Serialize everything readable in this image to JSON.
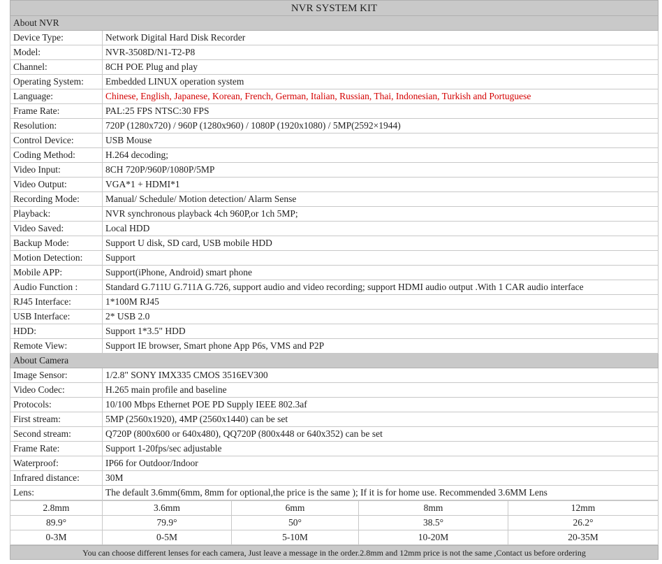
{
  "title": "NVR SYSTEM KIT",
  "sections": {
    "nvr": "About NVR",
    "camera": "About Camera"
  },
  "nvr_rows": [
    {
      "label": "Device Type:",
      "value": "Network Digital Hard Disk Recorder"
    },
    {
      "label": "Model:",
      "value": "NVR-3508D/N1-T2-P8"
    },
    {
      "label": "Channel:",
      "value": "8CH POE Plug and play"
    },
    {
      "label": "Operating System:",
      "value": "Embedded LINUX operation system"
    },
    {
      "label": "Language:",
      "value": "Chinese, English, Japanese, Korean, French, German, Italian, Russian, Thai, Indonesian, Turkish and Portuguese"
    },
    {
      "label": "Frame Rate:",
      "value": "PAL:25 FPS        NTSC:30 FPS"
    },
    {
      "label": "Resolution:",
      "value": "720P (1280x720) / 960P (1280x960) / 1080P (1920x1080) / 5MP(2592×1944)"
    },
    {
      "label": "Control  Device:",
      "value": "USB Mouse"
    },
    {
      "label": "Coding  Method:",
      "value": "H.264 decoding;"
    },
    {
      "label": "Video Input:",
      "value": "8CH 720P/960P/1080P/5MP"
    },
    {
      "label": "Video Output:",
      "value": "VGA*1  + HDMI*1"
    },
    {
      "label": "Recording Mode:",
      "value": "Manual/ Schedule/ Motion detection/ Alarm Sense"
    },
    {
      "label": "Playback:",
      "value": "NVR synchronous playback 4ch 960P,or 1ch 5MP;"
    },
    {
      "label": "Video Saved:",
      "value": "Local HDD"
    },
    {
      "label": "Backup Mode:",
      "value": "Support U disk, SD card, USB mobile HDD"
    },
    {
      "label": "Motion Detection:",
      "value": "Support"
    },
    {
      "label": "Mobile APP:",
      "value": "Support(iPhone, Android) smart phone"
    },
    {
      "label": "Audio Function :",
      "value": "Standard G.711U G.711A G.726, support audio and video recording; support HDMI audio output .With 1 CAR audio interface"
    },
    {
      "label": "RJ45  Interface:",
      "value": "1*100M RJ45"
    },
    {
      "label": "USB Interface:",
      "value": "2* USB 2.0"
    },
    {
      "label": "HDD:",
      "value": "Support 1*3.5\" HDD"
    },
    {
      "label": "Remote View:",
      "value": "Support IE browser, Smart phone App P6s, VMS and P2P"
    }
  ],
  "camera_rows": [
    {
      "label": "Image Sensor:",
      "value": "1/2.8\" SONY IMX335 CMOS  3516EV300"
    },
    {
      "label": "Video Codec:",
      "value": "H.265 main profile and baseline"
    },
    {
      "label": "Protocols:",
      "value": "10/100 Mbps Ethernet POE PD Supply IEEE 802.3af"
    },
    {
      "label": "First stream:",
      "value": "5MP (2560x1920), 4MP (2560x1440) can be set"
    },
    {
      "label": "Second stream:",
      "value": "Q720P (800x600 or 640x480), QQ720P (800x448 or 640x352) can be set"
    },
    {
      "label": "Frame Rate:",
      "value": "Support 1-20fps/sec adjustable"
    },
    {
      "label": "Waterproof:",
      "value": "IP66 for Outdoor/Indoor"
    },
    {
      "label": "Infrared distance:",
      "value": "30M"
    },
    {
      "label": "Lens:",
      "value": "The default 3.6mm(6mm, 8mm for optional,the price is the same ); If it is for home use. Recommended 3.6MM Lens"
    }
  ],
  "lens_table": [
    [
      "2.8mm",
      "3.6mm",
      "6mm",
      "8mm",
      "12mm"
    ],
    [
      "89.9°",
      "79.9°",
      "50°",
      "38.5°",
      "26.2°"
    ],
    [
      "0-3M",
      "0-5M",
      "5-10M",
      "10-20M",
      "20-35M"
    ]
  ],
  "footer": "You can choose different lenses for each camera, Just leave a message in the order.2.8mm and 12mm price is not the same ,Contact us before ordering",
  "colors": {
    "header_bg": "#c9c9c9",
    "highlight_text": "#d40000",
    "border": "#c8c8c8"
  }
}
